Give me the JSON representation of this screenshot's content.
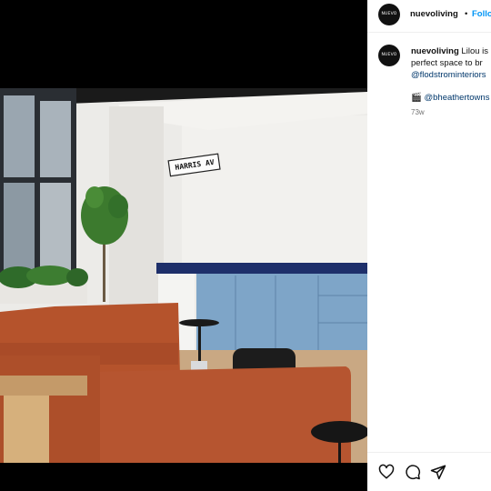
{
  "post": {
    "avatar_text": "NUEVO",
    "username": "nuevoliving",
    "dot": "•",
    "follow_label": "Follo",
    "caption": {
      "username": "nuevoliving",
      "line1_text": " Lilou is",
      "line2": "perfect space to br",
      "line3": "@flodstrominteriors"
    },
    "credit_icon": "clapper-board-icon",
    "credit": "@bheathertowns",
    "age": "73w"
  },
  "image": {
    "sign_text": "HARRIS AV",
    "description_colors": {
      "sofa": "#b5532c",
      "cabinets": "#7ea5c8",
      "countertop": "#1e2f6a",
      "wall": "#ecebe8"
    }
  },
  "actions": {
    "icons": [
      "heart-icon",
      "comment-icon",
      "share-icon"
    ]
  }
}
